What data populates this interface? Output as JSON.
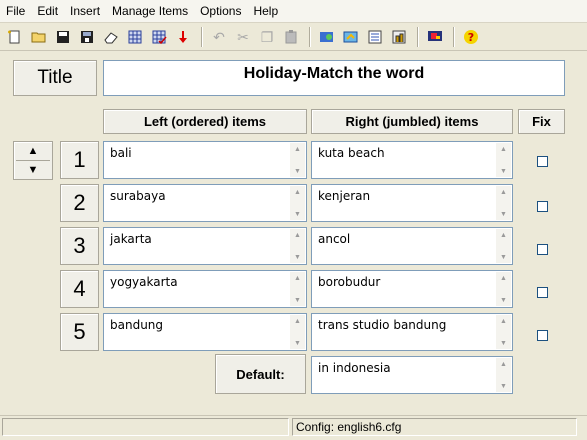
{
  "menu": [
    "File",
    "Edit",
    "Insert",
    "Manage Items",
    "Options",
    "Help"
  ],
  "toolbar": {
    "icons": [
      "new-file-icon",
      "open-folder-icon",
      "save-icon",
      "save-all-icon",
      "eraser-icon",
      "grid-icon",
      "grid-check-icon",
      "red-arrow-down-icon",
      "undo-icon",
      "cut-icon",
      "copy-icon",
      "paste-icon",
      "web-export-icon",
      "export-icon",
      "app-icon",
      "config-icon",
      "display-icon",
      "help-icon"
    ]
  },
  "title_label": "Title",
  "title_value": "Holiday-Match the word",
  "headers": {
    "left": "Left (ordered) items",
    "right": "Right (jumbled) items",
    "fix": "Fix"
  },
  "move": {
    "up": "▲",
    "down": "▼"
  },
  "rows": [
    {
      "num": "1",
      "left": "bali",
      "right": "kuta beach"
    },
    {
      "num": "2",
      "left": "surabaya",
      "right": "kenjeran"
    },
    {
      "num": "3",
      "left": "jakarta",
      "right": "ancol"
    },
    {
      "num": "4",
      "left": "yogyakarta",
      "right": "borobudur"
    },
    {
      "num": "5",
      "left": "bandung",
      "right": "trans studio bandung"
    }
  ],
  "default_label": "Default:",
  "default_value": "in indonesia",
  "status": {
    "config": "Config: english6.cfg"
  }
}
